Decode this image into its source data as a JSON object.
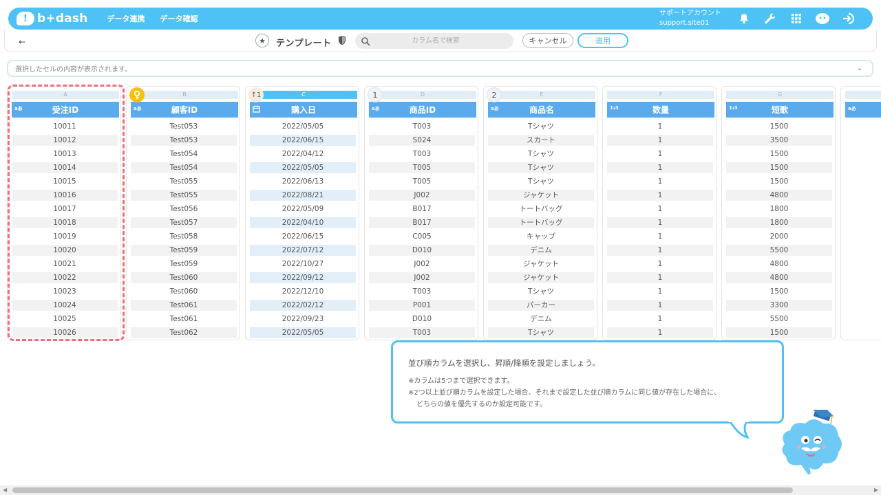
{
  "header": {
    "logo_text": "b+dash",
    "nav": [
      "データ連携",
      "データ確認"
    ],
    "account_name": "サポートアカウント",
    "account_id": "support.site01"
  },
  "toolbar": {
    "back": "←",
    "template_label": "テンプレート",
    "search_placeholder": "カラム名で検索",
    "cancel": "キャンセル",
    "apply": "適用"
  },
  "cell_bar": {
    "placeholder": "選択したセルの内容が表示されます。"
  },
  "columns": [
    {
      "letter": "A",
      "name": "受注ID",
      "type": "aあ",
      "badge": "",
      "values": [
        "10011",
        "10012",
        "10013",
        "10014",
        "10015",
        "10016",
        "10017",
        "10018",
        "10019",
        "10020",
        "10021",
        "10022",
        "10023",
        "10024",
        "10025",
        "10026"
      ]
    },
    {
      "letter": "B",
      "name": "顧客ID",
      "type": "aあ",
      "badge": "key",
      "values": [
        "Test053",
        "Test053",
        "Test054",
        "Test054",
        "Test055",
        "Test055",
        "Test056",
        "Test057",
        "Test058",
        "Test059",
        "Test059",
        "Test060",
        "Test060",
        "Test061",
        "Test061",
        "Test062"
      ]
    },
    {
      "letter": "C",
      "name": "購入日",
      "type": "cal",
      "badge": "↑1",
      "values": [
        "2022/05/05",
        "2022/06/15",
        "2022/04/12",
        "2022/05/05",
        "2022/06/13",
        "2022/08/21",
        "2022/05/09",
        "2022/04/10",
        "2022/06/15",
        "2022/07/12",
        "2022/10/27",
        "2022/09/12",
        "2022/12/10",
        "2022/02/12",
        "2022/09/23",
        "2022/05/05"
      ]
    },
    {
      "letter": "D",
      "name": "商品ID",
      "type": "aあ",
      "badge": "1",
      "values": [
        "T003",
        "S024",
        "T003",
        "T005",
        "T005",
        "J002",
        "B017",
        "B017",
        "C005",
        "D010",
        "J002",
        "J002",
        "T003",
        "P001",
        "D010",
        "T003"
      ]
    },
    {
      "letter": "E",
      "name": "商品名",
      "type": "aあ",
      "badge": "2",
      "values": [
        "Tシャツ",
        "スカート",
        "Tシャツ",
        "Tシャツ",
        "Tシャツ",
        "ジャケット",
        "トートバッグ",
        "トートバッグ",
        "キャップ",
        "デニム",
        "ジャケット",
        "ジャケット",
        "Tシャツ",
        "パーカー",
        "デニム",
        "Tシャツ"
      ]
    },
    {
      "letter": "F",
      "name": "数量",
      "type": "1₂3",
      "badge": "",
      "values": [
        "1",
        "1",
        "1",
        "1",
        "1",
        "1",
        "1",
        "1",
        "1",
        "1",
        "1",
        "1",
        "1",
        "1",
        "1",
        "1"
      ]
    },
    {
      "letter": "G",
      "name": "短歌",
      "type": "1₂3",
      "badge": "",
      "values": [
        "1500",
        "3500",
        "1500",
        "1500",
        "1500",
        "4800",
        "1800",
        "1800",
        "2000",
        "5500",
        "4800",
        "4800",
        "1500",
        "3300",
        "5500",
        "1500"
      ]
    },
    {
      "letter": "",
      "name": "",
      "type": "aあ",
      "badge": "",
      "values": []
    }
  ],
  "tooltip": {
    "main": "並び順カラムを選択し、昇順/降順を設定しましょう。",
    "note1": "※カラムは5つまで選択できます。",
    "note2": "※2つ以上並び順カラムを設定した場合、それまで設定した並び順カラムに同じ値が存在した場合に、",
    "note3": "どちらの値を優先するのか設定可能です。"
  },
  "colors": {
    "brand": "#4ec2f5",
    "header": "#5aabee",
    "selected_outline": "#ee6f7a",
    "key_badge": "#f5c013"
  }
}
